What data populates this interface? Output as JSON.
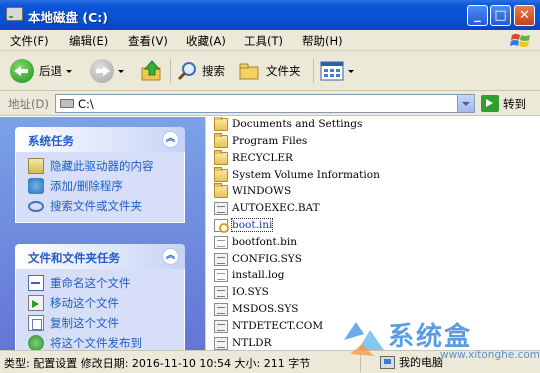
{
  "window": {
    "title": "本地磁盘 (C:)",
    "buttons": {
      "minimize": "_",
      "maximize": "□",
      "close": "✕"
    }
  },
  "menu": [
    "文件(F)",
    "编辑(E)",
    "查看(V)",
    "收藏(A)",
    "工具(T)",
    "帮助(H)"
  ],
  "toolbar": {
    "back": "后退",
    "search": "搜索",
    "folders": "文件夹"
  },
  "address": {
    "label": "地址(D)",
    "value": "C:\\",
    "go": "转到"
  },
  "tasks": {
    "system": {
      "title": "系统任务",
      "items": [
        "隐藏此驱动器的内容",
        "添加/删除程序",
        "搜索文件或文件夹"
      ]
    },
    "file_folder": {
      "title": "文件和文件夹任务",
      "items": [
        "重命名这个文件",
        "移动这个文件",
        "复制这个文件",
        "将这个文件发布到"
      ]
    }
  },
  "files": [
    {
      "name": "Documents and Settings",
      "icon": "folder-icon"
    },
    {
      "name": "Program Files",
      "icon": "folder-icon"
    },
    {
      "name": "RECYCLER",
      "icon": "folder-icon"
    },
    {
      "name": "System Volume Information",
      "icon": "folder-icon"
    },
    {
      "name": "WINDOWS",
      "icon": "folder-icon"
    },
    {
      "name": "AUTOEXEC.BAT",
      "icon": "system-file-icon"
    },
    {
      "name": "boot.ini",
      "icon": "settings-file-icon",
      "selected": true
    },
    {
      "name": "bootfont.bin",
      "icon": "document-icon"
    },
    {
      "name": "CONFIG.SYS",
      "icon": "system-file-icon"
    },
    {
      "name": "install.log",
      "icon": "document-icon"
    },
    {
      "name": "IO.SYS",
      "icon": "system-file-icon"
    },
    {
      "name": "MSDOS.SYS",
      "icon": "system-file-icon"
    },
    {
      "name": "NTDETECT.COM",
      "icon": "system-file-icon"
    },
    {
      "name": "NTLDR",
      "icon": "system-file-icon"
    }
  ],
  "status": {
    "text": "类型: 配置设置 修改日期: 2016-11-10 10:54 大小: 211 字节",
    "zone": "我的电脑"
  },
  "watermark": {
    "brand": "系统盒",
    "url": "www.xitonghe.com"
  },
  "colors": {
    "titlebar": "#0751d0",
    "taskpane": "#6f8ee0",
    "task_text": "#215dc6"
  }
}
